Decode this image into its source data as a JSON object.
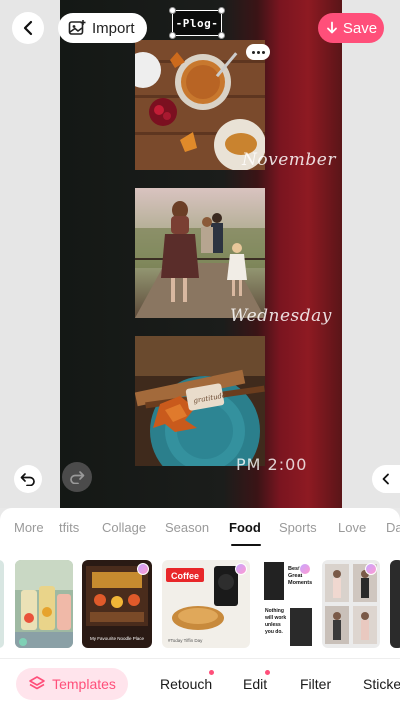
{
  "topbar": {
    "import_label": "Import",
    "save_label": "Save",
    "sticker_text": "-Plog-"
  },
  "canvas": {
    "month_text": "November",
    "day_text": "Wednesday",
    "time_text": "PM 2:00",
    "tag_text": "gratitude"
  },
  "category_tabs": [
    "More",
    "tfits",
    "Collage",
    "Season",
    "Food",
    "Sports",
    "Love",
    "Da"
  ],
  "active_tab": "Food",
  "templates": [
    {
      "name": "drinks-template"
    },
    {
      "name": "noodle-place-template",
      "caption": "My Favourite Noodle Place"
    },
    {
      "name": "coffee-template",
      "title": "Coffee",
      "caption": "#Today Tiffin Day"
    },
    {
      "name": "fashion-text-template",
      "lines": [
        "Best",
        "Great",
        "Moments",
        "Nothing",
        "will work",
        "unless",
        "you do."
      ]
    },
    {
      "name": "fitness-collage-template"
    }
  ],
  "bottom_nav": {
    "templates_label": "Templates",
    "retouch_label": "Retouch",
    "edit_label": "Edit",
    "filter_label": "Filter",
    "stickers_label": "Sticke"
  },
  "colors": {
    "accent": "#ff4f7a",
    "accent_light": "#ffe4ec"
  },
  "icons": [
    "back-icon",
    "import-image-icon",
    "download-icon",
    "undo-icon",
    "redo-icon",
    "collapse-left-icon",
    "more-dots-icon",
    "templates-layers-icon"
  ]
}
